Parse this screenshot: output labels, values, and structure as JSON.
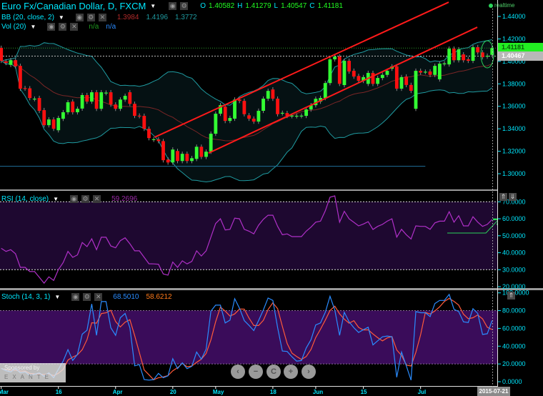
{
  "header": {
    "title": "Euro Fx/Canadian Dollar, D, FXCM",
    "ohlc": {
      "o_label": "O",
      "o": "1.40582",
      "h_label": "H",
      "h": "1.41279",
      "l_label": "L",
      "l": "1.40547",
      "c_label": "C",
      "c": "1.41181"
    },
    "realtime_label": "realtime"
  },
  "indicators": {
    "bb": {
      "label": "BB (20, close, 2)",
      "middle": "1.3984",
      "upper": "1.4196",
      "lower": "1.3772"
    },
    "vol": {
      "label": "Vol (20)",
      "value1": "n/a",
      "value2": "n/a"
    },
    "rsi": {
      "label": "RSI (14, close)",
      "value": "59.2696"
    },
    "stoch": {
      "label": "Stoch (14, 3, 1)",
      "k": "68.5010",
      "d": "58.6212"
    }
  },
  "icons": {
    "eye": "◉",
    "gear": "⚙",
    "close": "✕",
    "caret": "▼",
    "up": "⇑",
    "down": "⇓"
  },
  "price_tags": {
    "last": "1.41181",
    "bid": "1.40467"
  },
  "sponsor": {
    "line1": "Sponsored by",
    "line2": "EXANTE"
  },
  "nav_buttons": [
    "‹",
    "−",
    "C",
    "+",
    "›"
  ],
  "current_date": "2015-07-21",
  "colors": {
    "up": "#33ff33",
    "down": "#ff1010",
    "band": "#1f9aa0",
    "mid": "#7a2626",
    "rsi": "#b030c8",
    "k": "#2a8cff",
    "d": "#ff5a3a",
    "axis": "#00e8ff"
  },
  "chart_data": [
    {
      "type": "candlestick",
      "title": "Euro Fx/Canadian Dollar, D, FXCM",
      "x_labels": [
        {
          "label": "Mar",
          "index": 0
        },
        {
          "label": "16",
          "index": 12
        },
        {
          "label": "Apr",
          "index": 24
        },
        {
          "label": "20",
          "index": 36
        },
        {
          "label": "May",
          "index": 45
        },
        {
          "label": "18",
          "index": 57
        },
        {
          "label": "Jun",
          "index": 66
        },
        {
          "label": "15",
          "index": 76
        },
        {
          "label": "Jul",
          "index": 88
        }
      ],
      "y_ticks": [
        "1.44000",
        "1.42000",
        "1.40000",
        "1.38000",
        "1.36000",
        "1.34000",
        "1.32000",
        "1.30000"
      ],
      "ylim": [
        1.29,
        1.455
      ],
      "open_close": [
        [
          1.412,
          1.4005
        ],
        [
          1.4,
          1.3986
        ],
        [
          1.3969,
          1.4011
        ],
        [
          1.4011,
          1.3956
        ],
        [
          1.396,
          1.3757
        ],
        [
          1.3762,
          1.3758
        ],
        [
          1.376,
          1.3674
        ],
        [
          1.3664,
          1.3668
        ],
        [
          1.3674,
          1.356
        ],
        [
          1.3566,
          1.3432
        ],
        [
          1.3432,
          1.3483
        ],
        [
          1.3483,
          1.34
        ],
        [
          1.3387,
          1.3496
        ],
        [
          1.3489,
          1.3547
        ],
        [
          1.3547,
          1.3636
        ],
        [
          1.3642,
          1.3547
        ],
        [
          1.3547,
          1.3578
        ],
        [
          1.358,
          1.37
        ],
        [
          1.37,
          1.3642
        ],
        [
          1.3642,
          1.3725
        ],
        [
          1.3725,
          1.3578
        ],
        [
          1.3578,
          1.3725
        ],
        [
          1.3718,
          1.3722
        ],
        [
          1.3725,
          1.3616
        ],
        [
          1.3616,
          1.3578
        ],
        [
          1.3578,
          1.366
        ],
        [
          1.366,
          1.3693
        ],
        [
          1.3725,
          1.3622
        ],
        [
          1.3622,
          1.3515
        ],
        [
          1.3517,
          1.3513
        ],
        [
          1.3515,
          1.34
        ],
        [
          1.34,
          1.3317
        ],
        [
          1.3303,
          1.3307
        ],
        [
          1.3305,
          1.329
        ],
        [
          1.329,
          1.312
        ],
        [
          1.3126,
          1.31
        ],
        [
          1.31,
          1.3215
        ],
        [
          1.3202,
          1.3113
        ],
        [
          1.3113,
          1.3177
        ],
        [
          1.3177,
          1.3113
        ],
        [
          1.3113,
          1.3138
        ],
        [
          1.3132,
          1.324
        ],
        [
          1.324,
          1.315
        ],
        [
          1.315,
          1.3196
        ],
        [
          1.3196,
          1.3356
        ],
        [
          1.3356,
          1.3534
        ],
        [
          1.3534,
          1.361
        ],
        [
          1.3597,
          1.347
        ],
        [
          1.347,
          1.3496
        ],
        [
          1.349,
          1.366
        ],
        [
          1.366,
          1.3648
        ],
        [
          1.3648,
          1.353
        ],
        [
          1.352,
          1.349
        ],
        [
          1.349,
          1.3464
        ],
        [
          1.3464,
          1.356
        ],
        [
          1.356,
          1.3668
        ],
        [
          1.3668,
          1.3737
        ],
        [
          1.375,
          1.3668
        ],
        [
          1.3668,
          1.353
        ],
        [
          1.3538,
          1.3542
        ],
        [
          1.354,
          1.3515
        ],
        [
          1.3513,
          1.3517
        ],
        [
          1.3512,
          1.3516
        ],
        [
          1.3513,
          1.3517
        ],
        [
          1.3515,
          1.3572
        ],
        [
          1.3572,
          1.361
        ],
        [
          1.361,
          1.3667
        ],
        [
          1.3642,
          1.3674
        ],
        [
          1.3674,
          1.3807
        ],
        [
          1.3807,
          1.4018
        ],
        [
          1.4018,
          1.4043
        ],
        [
          1.4043,
          1.38
        ],
        [
          1.3789,
          1.4005
        ],
        [
          1.4005,
          1.391
        ],
        [
          1.3916,
          1.3865
        ],
        [
          1.387,
          1.3827
        ],
        [
          1.3827,
          1.386
        ],
        [
          1.38,
          1.3897
        ],
        [
          1.3897,
          1.38
        ],
        [
          1.38,
          1.3852
        ],
        [
          1.3852,
          1.388
        ],
        [
          1.388,
          1.3916
        ],
        [
          1.3935,
          1.3955
        ],
        [
          1.3955,
          1.3757
        ],
        [
          1.3757,
          1.386
        ],
        [
          1.3865,
          1.379
        ],
        [
          1.379,
          1.3738
        ],
        [
          1.3578,
          1.3916
        ],
        [
          1.3916,
          1.39
        ],
        [
          1.3905,
          1.3908
        ],
        [
          1.391,
          1.388
        ],
        [
          1.388,
          1.396
        ],
        [
          1.384,
          1.398
        ],
        [
          1.3978,
          1.3982
        ],
        [
          1.3973,
          1.4113
        ],
        [
          1.4113,
          1.401
        ],
        [
          1.401,
          1.4107
        ],
        [
          1.4062,
          1.401
        ],
        [
          1.4018,
          1.4005
        ],
        [
          1.4005,
          1.4126
        ],
        [
          1.4126,
          1.408
        ],
        [
          1.408,
          1.4037
        ],
        [
          1.4043,
          1.405
        ],
        [
          1.40582,
          1.41181
        ]
      ],
      "trendlines": [
        {
          "name": "upper-channel",
          "from": {
            "index": 32.2,
            "price": 1.3325
          },
          "to": {
            "index": 93.9,
            "price": 1.4527
          }
        },
        {
          "name": "lower-channel",
          "from": {
            "index": 43.5,
            "price": 1.3183
          },
          "to": {
            "index": 99.9,
            "price": 1.4304
          }
        }
      ],
      "support_level": {
        "price": 1.3066,
        "to_index": 89
      },
      "last_price": 1.41181,
      "bid_price": 1.40467
    },
    {
      "type": "line",
      "title": "RSI (14, close)",
      "y_ticks": [
        "70.0000",
        "60.0000",
        "50.0000",
        "40.0000",
        "30.0000",
        "20.0000"
      ],
      "bands": [
        30,
        70
      ],
      "values": [
        42.6,
        40.8,
        41.8,
        39.4,
        31.4,
        31.4,
        28.9,
        28.9,
        25.5,
        22.1,
        25.8,
        23.7,
        30,
        34.2,
        40.8,
        37.3,
        38.7,
        46,
        43.6,
        48.2,
        41.8,
        49.1,
        49.1,
        44,
        42.9,
        47.1,
        48.8,
        45.3,
        41.1,
        41.1,
        37.3,
        33.5,
        33.4,
        33.2,
        27.5,
        26.8,
        34.5,
        31.4,
        35.2,
        33.4,
        34.9,
        41.1,
        38.1,
        41.1,
        49.2,
        57.2,
        60,
        53.4,
        53.8,
        60.4,
        60,
        53.8,
        52.7,
        51.1,
        56.2,
        59.7,
        62.1,
        62.1,
        55.5,
        50.6,
        51.1,
        49.5,
        49.5,
        49.5,
        52.7,
        55.1,
        58,
        58.6,
        64.7,
        72.7,
        73.5,
        58,
        64.4,
        60,
        57.9,
        55.8,
        56.9,
        58.3,
        53.7,
        55.5,
        56.7,
        58.6,
        60,
        49.2,
        53.8,
        50.6,
        48.1,
        55.8,
        55.5,
        55.5,
        53.8,
        57.6,
        58.6,
        58.6,
        64.2,
        58,
        61.8,
        55.8,
        55.8,
        61.2,
        58,
        55.5,
        56.7,
        59.5
      ],
      "annotation": {
        "from": {
          "index": 93.6,
          "value": 51.6
        },
        "corner": {
          "index": 101.7,
          "value": 51.6
        },
        "to": {
          "index": 104.4,
          "value": 59.7
        }
      }
    },
    {
      "type": "line",
      "title": "Stoch (14, 3, 1)",
      "y_ticks": [
        "100.0000",
        "80.0000",
        "60.0000",
        "40.0000",
        "20.0000",
        "0.0000"
      ],
      "bands": [
        20,
        80
      ],
      "k_values": [
        15,
        12.5,
        11,
        15,
        10,
        11,
        7,
        8.5,
        10,
        6,
        10,
        4.5,
        13.9,
        23.2,
        36.1,
        24,
        30.7,
        53.5,
        58,
        87.5,
        52.2,
        90.2,
        90.2,
        60.7,
        52.2,
        72,
        76.8,
        60.7,
        17.9,
        19.2,
        2.4,
        1.8,
        2.4,
        9.3,
        4.5,
        6.6,
        25.9,
        14.7,
        21.2,
        14.7,
        17.3,
        33.4,
        25.4,
        36.6,
        79.5,
        86.2,
        86.2,
        66.1,
        69.3,
        93.4,
        82.7,
        68.8,
        63.4,
        57.5,
        68.8,
        80.8,
        94.2,
        91.5,
        60.7,
        34.5,
        34,
        28.1,
        23.2,
        23.8,
        38,
        47.3,
        63.9,
        66.1,
        78.1,
        96.1,
        80.8,
        52.2,
        78.1,
        67.4,
        60.7,
        55.4,
        58.6,
        61.3,
        41.4,
        46,
        50.5,
        51.4,
        50.5,
        5,
        33.4,
        17.9,
        1.8,
        78.9,
        77.6,
        77.6,
        73.3,
        88,
        91.5,
        91.5,
        98.2,
        81.6,
        78.9,
        67.4,
        66.6,
        82.1,
        76.8,
        53.2,
        54,
        68.8
      ],
      "d_period": 3
    }
  ]
}
